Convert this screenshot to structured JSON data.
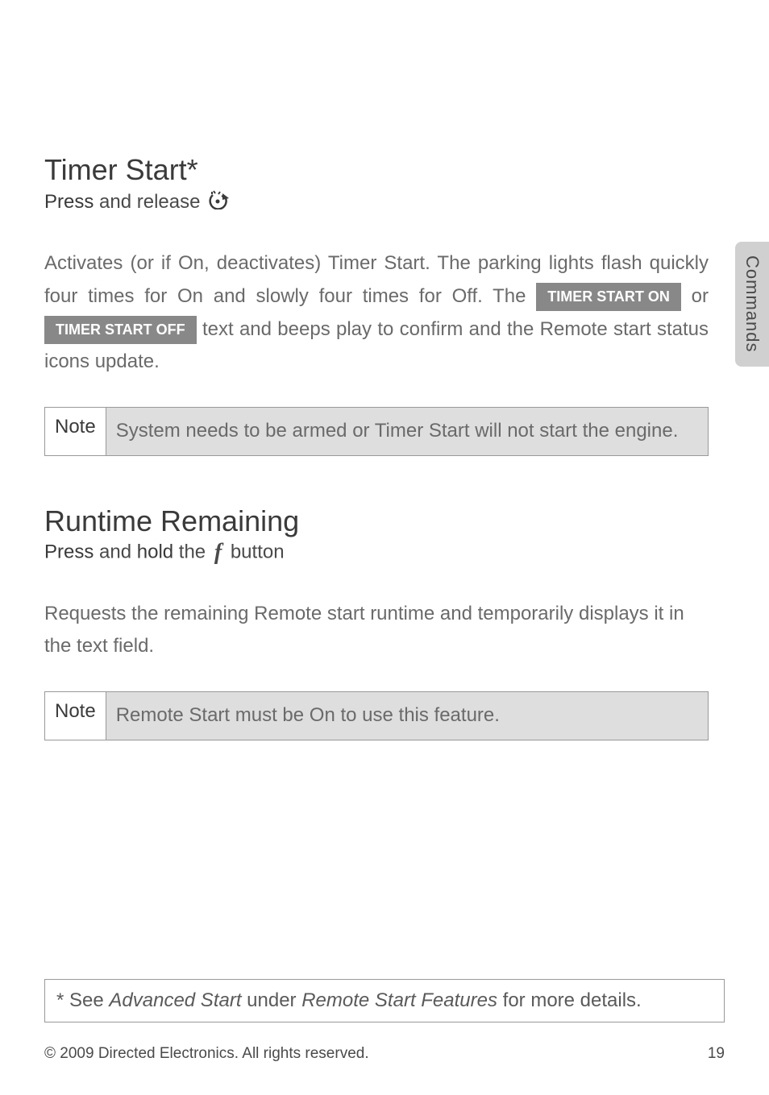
{
  "sideTab": "Commands",
  "section1": {
    "heading": "Timer Start*",
    "subheading": {
      "strong1": "Press",
      "text1": " and release "
    },
    "body": {
      "part1": "Activates (or if On, deactivates) Timer Start. The parking lights flash quickly four times for On and slowly four times for Off. The ",
      "label1": "TIMER START ON",
      "middle": " or ",
      "label2": "TIMER START OFF",
      "part2": " text and beeps play to confirm and the Remote start status icons update."
    },
    "note": {
      "label": "Note",
      "content": "System needs to be armed or Timer Start will not start the engine."
    }
  },
  "section2": {
    "heading": "Runtime Remaining",
    "subheading": {
      "strong1": "Press",
      "text1": " and ",
      "strong2": "hold",
      "text2": " the ",
      "fIcon": "f",
      "text3": " button"
    },
    "body": "Requests the remaining Remote start runtime and temporarily displays it in the text field.",
    "note": {
      "label": "Note",
      "content": "Remote Start must be On to use this feature."
    }
  },
  "footnote": {
    "prefix": "* See ",
    "em1": "Advanced Start",
    "mid": " under ",
    "em2": "Remote Start Features",
    "suffix": " for more details."
  },
  "footer": {
    "copyright": "© 2009 Directed Electronics. All rights reserved.",
    "page": "19"
  }
}
